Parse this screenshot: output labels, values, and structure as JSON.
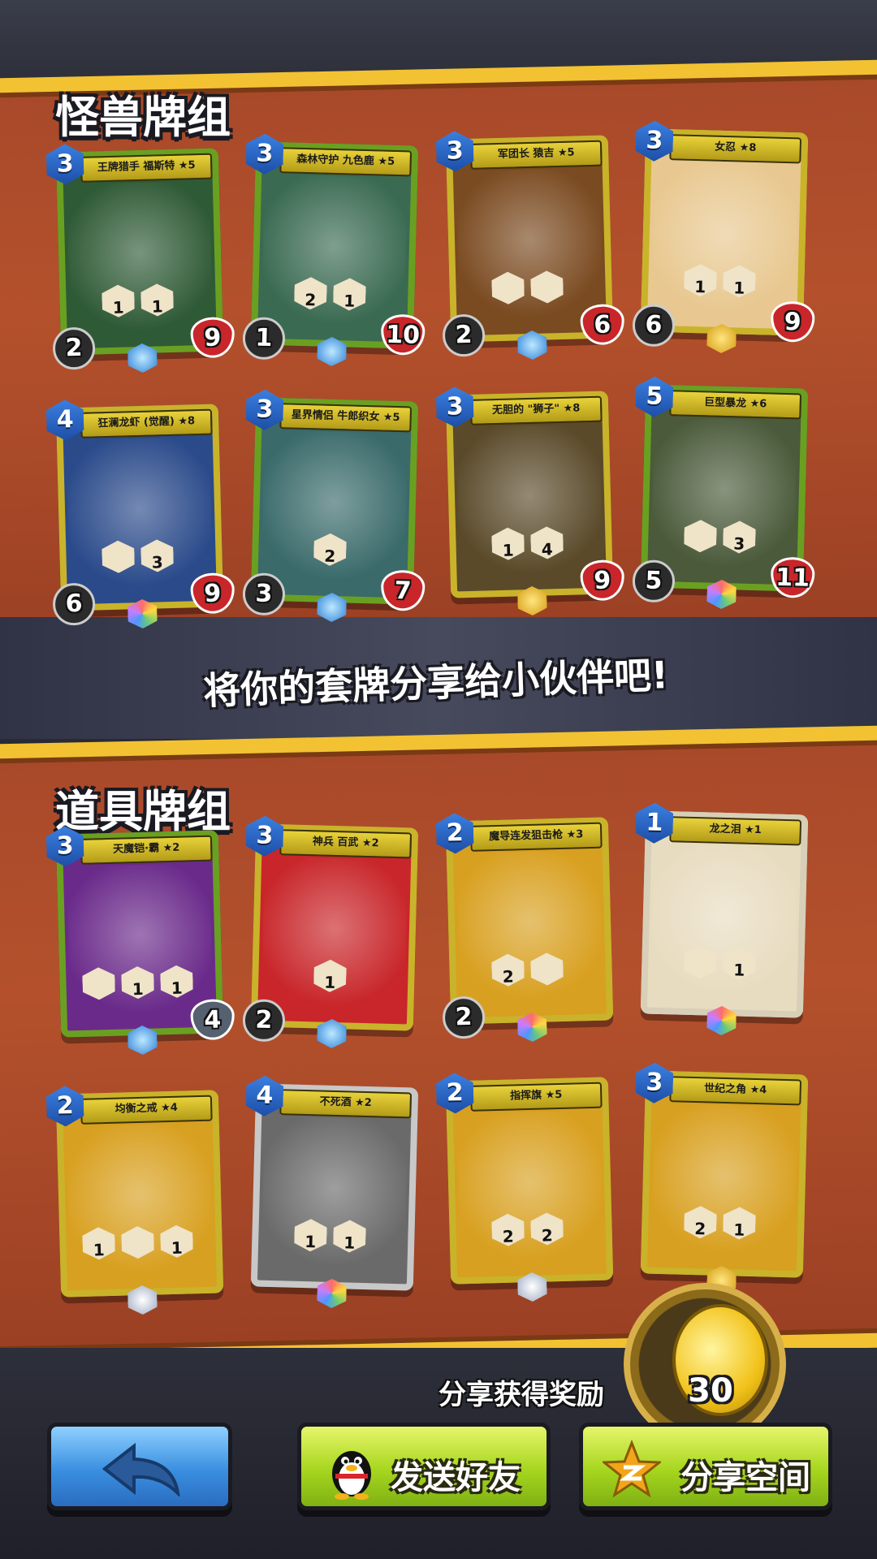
{
  "sections": {
    "monster_title": "怪兽牌组",
    "item_title": "道具牌组",
    "share_prompt": "将你的套牌分享给小伙伴吧!"
  },
  "monster_cards": [
    {
      "name": "王牌猎手 福斯特 ★5",
      "cost": "3",
      "attack": "2",
      "health": "9",
      "skills": [
        "1",
        "1"
      ],
      "gem": "star",
      "art_color": "#2f5a36"
    },
    {
      "name": "森林守护 九色鹿 ★5",
      "cost": "3",
      "attack": "1",
      "health": "10",
      "skills": [
        "2",
        "1"
      ],
      "gem": "star",
      "art_color": "#3a6a52"
    },
    {
      "name": "军团长 猿吉 ★5",
      "cost": "3",
      "attack": "2",
      "health": "6",
      "skills": [
        "",
        ""
      ],
      "gem": "star",
      "art_color": "#7a4a20"
    },
    {
      "name": "女忍 ★8",
      "cost": "3",
      "attack": "6",
      "health": "9",
      "skills": [
        "1",
        "1"
      ],
      "gem": "gold",
      "art_color": "#e8c890"
    },
    {
      "name": "狂澜龙虾 (觉醒) ★8",
      "cost": "4",
      "attack": "6",
      "health": "9",
      "skills": [
        "",
        "3"
      ],
      "gem": "rainbow",
      "art_color": "#2a4a8a"
    },
    {
      "name": "星界情侣 牛郎织女 ★5",
      "cost": "3",
      "attack": "3",
      "health": "7",
      "skills": [
        "2"
      ],
      "gem": "star",
      "art_color": "#3a6a6a"
    },
    {
      "name": "无胆的 \"狮子\" ★8",
      "cost": "3",
      "attack": "",
      "health": "9",
      "skills": [
        "1",
        "4"
      ],
      "gem": "gold",
      "art_color": "#5a4a2a"
    },
    {
      "name": "巨型暴龙 ★6",
      "cost": "5",
      "attack": "5",
      "health": "11",
      "skills": [
        "",
        "3"
      ],
      "gem": "rainbow",
      "art_color": "#4a5a3a"
    }
  ],
  "item_cards": [
    {
      "name": "天魔铠·霸 ★2",
      "cost": "3",
      "attack": "",
      "health": "4",
      "skills": [
        "",
        "1",
        "1"
      ],
      "gem": "star",
      "art_color": "#6a2a8a"
    },
    {
      "name": "神兵 百武 ★2",
      "cost": "3",
      "attack": "2",
      "health": "",
      "skills": [
        "1"
      ],
      "gem": "star",
      "art_color": "#c8262a"
    },
    {
      "name": "魔导连发狙击枪 ★3",
      "cost": "2",
      "attack": "2",
      "health": "",
      "skills": [
        "2",
        ""
      ],
      "gem": "rainbow",
      "art_color": "#d8a020"
    },
    {
      "name": "龙之泪 ★1",
      "cost": "1",
      "attack": "",
      "health": "",
      "skills": [
        "",
        "1"
      ],
      "gem": "rainbow",
      "art_color": "#e8dcc0"
    },
    {
      "name": "均衡之戒 ★4",
      "cost": "2",
      "attack": "",
      "health": "",
      "skills": [
        "1",
        "",
        "1"
      ],
      "gem": "silver",
      "art_color": "#d8a020"
    },
    {
      "name": "不死酒 ★2",
      "cost": "4",
      "attack": "",
      "health": "",
      "skills": [
        "1",
        "1"
      ],
      "gem": "rainbow",
      "art_color": "#6a6a6a"
    },
    {
      "name": "指挥旗 ★5",
      "cost": "2",
      "attack": "",
      "health": "",
      "skills": [
        "2",
        "2"
      ],
      "gem": "silver",
      "art_color": "#d8a020"
    },
    {
      "name": "世纪之角 ★4",
      "cost": "3",
      "attack": "",
      "health": "",
      "skills": [
        "2",
        "1"
      ],
      "gem": "gold",
      "art_color": "#d8a020"
    }
  ],
  "reward": {
    "label": "分享获得奖励",
    "amount": "30"
  },
  "buttons": {
    "back_icon": "back-arrow-icon",
    "send_friend": "发送好友",
    "share_space": "分享空间"
  },
  "colors": {
    "board": "#a8492a",
    "trim": "#f2c233",
    "green_btn": "#a6d61e",
    "blue_btn": "#3a8fe0"
  }
}
